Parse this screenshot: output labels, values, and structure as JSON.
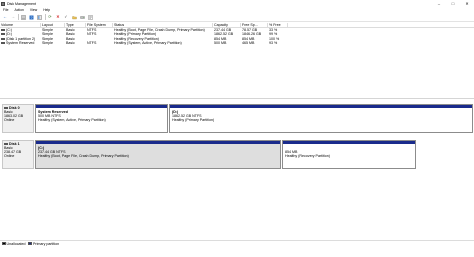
{
  "window": {
    "title": "Disk Management"
  },
  "menu": [
    "File",
    "Action",
    "View",
    "Help"
  ],
  "toolbar": {
    "icons": [
      "back-arrow-icon",
      "forward-arrow-icon",
      "disk-list-icon",
      "help-icon",
      "disk-list-alt-icon",
      "refresh-icon",
      "delete-icon",
      "check-icon",
      "folder-open-icon",
      "disk-icon",
      "properties-icon"
    ]
  },
  "volumes": {
    "headers": [
      "Volume",
      "Layout",
      "Type",
      "File System",
      "Status",
      "Capacity",
      "Free Sp...",
      "% Free"
    ],
    "rows": [
      {
        "volume": "(C:)",
        "layout": "Simple",
        "type": "Basic",
        "fs": "NTFS",
        "status": "Healthy (Boot, Page File, Crash Dump, Primary Partition)",
        "capacity": "237.44 GB",
        "free": "78.57 GB",
        "pct": "33 %"
      },
      {
        "volume": "(D:)",
        "layout": "Simple",
        "type": "Basic",
        "fs": "NTFS",
        "status": "Healthy (Primary Partition)",
        "capacity": "1862.52 GB",
        "free": "1846.26 GB",
        "pct": "99 %"
      },
      {
        "volume": "(Disk 1 partition 2)",
        "layout": "Simple",
        "type": "Basic",
        "fs": "",
        "status": "Healthy (Recovery Partition)",
        "capacity": "854 MB",
        "free": "854 MB",
        "pct": "100 %"
      },
      {
        "volume": "System Reserved",
        "layout": "Simple",
        "type": "Basic",
        "fs": "NTFS",
        "status": "Healthy (System, Active, Primary Partition)",
        "capacity": "500 MB",
        "free": "465 MB",
        "pct": "93 %"
      }
    ]
  },
  "disks": [
    {
      "name": "Disk 0",
      "type": "Basic",
      "size": "1863.02 GB",
      "state": "Online",
      "partitions": [
        {
          "name": "System Reserved",
          "size": "500 MB NTFS",
          "status": "Healthy (System, Active, Primary Partition)",
          "selected": false
        },
        {
          "name": "(D:)",
          "size": "1862.52 GB NTFS",
          "status": "Healthy (Primary Partition)",
          "selected": false
        }
      ]
    },
    {
      "name": "Disk 1",
      "type": "Basic",
      "size": "238.47 GB",
      "state": "Online",
      "partitions": [
        {
          "name": "(C:)",
          "size": "237.44 GB NTFS",
          "status": "Healthy (Boot, Page File, Crash Dump, Primary Partition)",
          "selected": true
        },
        {
          "name": "",
          "size": "854 MB",
          "status": "Healthy (Recovery Partition)",
          "selected": false
        }
      ]
    }
  ],
  "legend": [
    {
      "label": "Unallocated",
      "color": "#000000"
    },
    {
      "label": "Primary partition",
      "color": "#1a2b8c"
    }
  ]
}
